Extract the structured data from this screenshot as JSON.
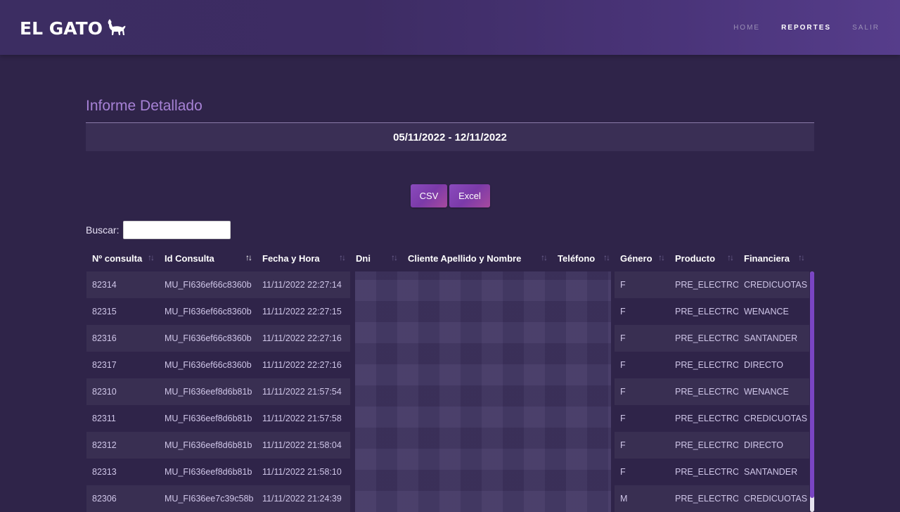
{
  "brand": {
    "logo_text": "EL GATO"
  },
  "nav": {
    "home": "HOME",
    "reportes": "REPORTES",
    "salir": "SALIR"
  },
  "page": {
    "title": "Informe Detallado",
    "date_range": "05/11/2022 - 12/11/2022"
  },
  "export": {
    "csv": "CSV",
    "excel": "Excel"
  },
  "search": {
    "label": "Buscar:",
    "value": ""
  },
  "table": {
    "columns": [
      "Nº consulta",
      "Id Consulta",
      "Fecha y Hora",
      "Dni",
      "Cliente Apellido y Nombre",
      "Teléfono",
      "Género",
      "Producto",
      "Financiera"
    ],
    "rows": [
      {
        "n": "82314",
        "id": "MU_FI636ef66c8360b",
        "fecha": "11/11/2022 22:27:14",
        "genero": "F",
        "producto": "PRE_ELECTRO",
        "financiera": "CREDICUOTAS"
      },
      {
        "n": "82315",
        "id": "MU_FI636ef66c8360b",
        "fecha": "11/11/2022 22:27:15",
        "genero": "F",
        "producto": "PRE_ELECTRO",
        "financiera": "WENANCE"
      },
      {
        "n": "82316",
        "id": "MU_FI636ef66c8360b",
        "fecha": "11/11/2022 22:27:16",
        "genero": "F",
        "producto": "PRE_ELECTRO",
        "financiera": "SANTANDER"
      },
      {
        "n": "82317",
        "id": "MU_FI636ef66c8360b",
        "fecha": "11/11/2022 22:27:16",
        "genero": "F",
        "producto": "PRE_ELECTRO",
        "financiera": "DIRECTO"
      },
      {
        "n": "82310",
        "id": "MU_FI636eef8d6b81b",
        "fecha": "11/11/2022 21:57:54",
        "genero": "F",
        "producto": "PRE_ELECTRO",
        "financiera": "WENANCE"
      },
      {
        "n": "82311",
        "id": "MU_FI636eef8d6b81b",
        "fecha": "11/11/2022 21:57:58",
        "genero": "F",
        "producto": "PRE_ELECTRO",
        "financiera": "CREDICUOTAS"
      },
      {
        "n": "82312",
        "id": "MU_FI636eef8d6b81b",
        "fecha": "11/11/2022 21:58:04",
        "genero": "F",
        "producto": "PRE_ELECTRO",
        "financiera": "DIRECTO"
      },
      {
        "n": "82313",
        "id": "MU_FI636eef8d6b81b",
        "fecha": "11/11/2022 21:58:10",
        "genero": "F",
        "producto": "PRE_ELECTRO",
        "financiera": "SANTANDER"
      },
      {
        "n": "82306",
        "id": "MU_FI636ee7c39c58b",
        "fecha": "11/11/2022 21:24:39",
        "genero": "M",
        "producto": "PRE_ELECTRO",
        "financiera": "CREDICUOTAS"
      }
    ]
  }
}
